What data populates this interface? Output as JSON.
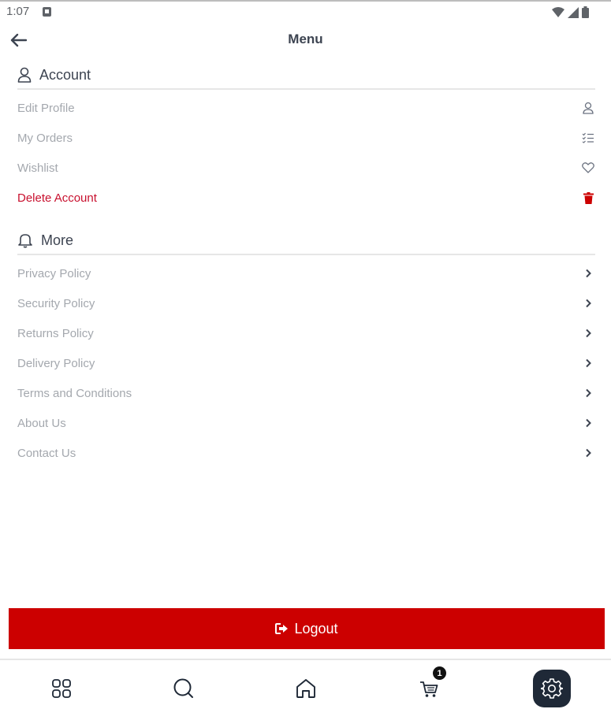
{
  "status_bar": {
    "time": "1:07"
  },
  "header": {
    "title": "Menu"
  },
  "account_section": {
    "title": "Account",
    "items": [
      {
        "label": "Edit Profile",
        "icon": "user-icon"
      },
      {
        "label": "My Orders",
        "icon": "list-icon"
      },
      {
        "label": "Wishlist",
        "icon": "heart-icon"
      },
      {
        "label": "Delete Account",
        "icon": "trash-icon"
      }
    ]
  },
  "more_section": {
    "title": "More",
    "items": [
      {
        "label": "Privacy Policy",
        "icon": "chevron-right-icon"
      },
      {
        "label": "Security Policy",
        "icon": "chevron-right-icon"
      },
      {
        "label": "Returns Policy",
        "icon": "chevron-right-icon"
      },
      {
        "label": "Delivery Policy",
        "icon": "chevron-right-icon"
      },
      {
        "label": "Terms and Conditions",
        "icon": "chevron-right-icon"
      },
      {
        "label": "About Us",
        "icon": "chevron-right-icon"
      },
      {
        "label": "Contact Us",
        "icon": "chevron-right-icon"
      }
    ]
  },
  "logout": {
    "label": "Logout"
  },
  "bottom_nav": {
    "items": [
      {
        "icon": "categories-icon"
      },
      {
        "icon": "search-icon"
      },
      {
        "icon": "home-icon"
      },
      {
        "icon": "cart-icon",
        "badge": "1"
      },
      {
        "icon": "settings-icon",
        "active": true
      }
    ]
  },
  "colors": {
    "accent": "#cc0000",
    "danger_text": "#c8102e",
    "active_nav": "#1f2937",
    "muted_text": "#a4a8ae"
  }
}
